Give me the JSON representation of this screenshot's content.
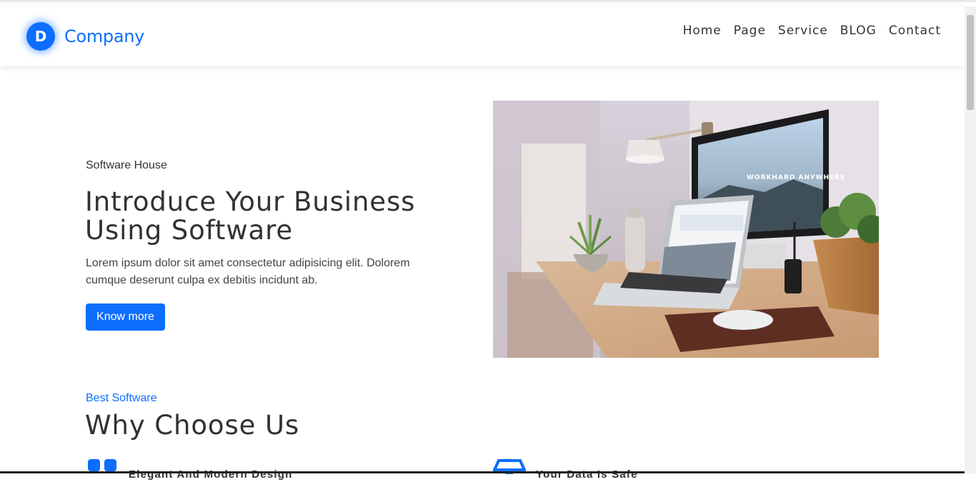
{
  "brand": {
    "letter": "D",
    "name": "Company"
  },
  "nav": {
    "items": [
      "Home",
      "Page",
      "Service",
      "BLOG",
      "Contact"
    ]
  },
  "hero": {
    "kicker": "Software House",
    "title": "Introduce Your Business Using Software",
    "text": "Lorem ipsum dolor sit amet consectetur adipisicing elit. Dolorem cumque deserunt culpa ex debitis incidunt ab.",
    "button": "Know more",
    "image_screen_text": "WORKHARD ANYWHERE"
  },
  "why": {
    "kicker": "Best Software",
    "title": "Why Choose Us",
    "features": [
      {
        "icon": "grid-icon",
        "title": "Elegant And Modern Design"
      },
      {
        "icon": "box-icon",
        "title": "Your Data Is Safe"
      }
    ]
  },
  "colors": {
    "accent": "#0d6efd",
    "text": "#2f3235"
  }
}
